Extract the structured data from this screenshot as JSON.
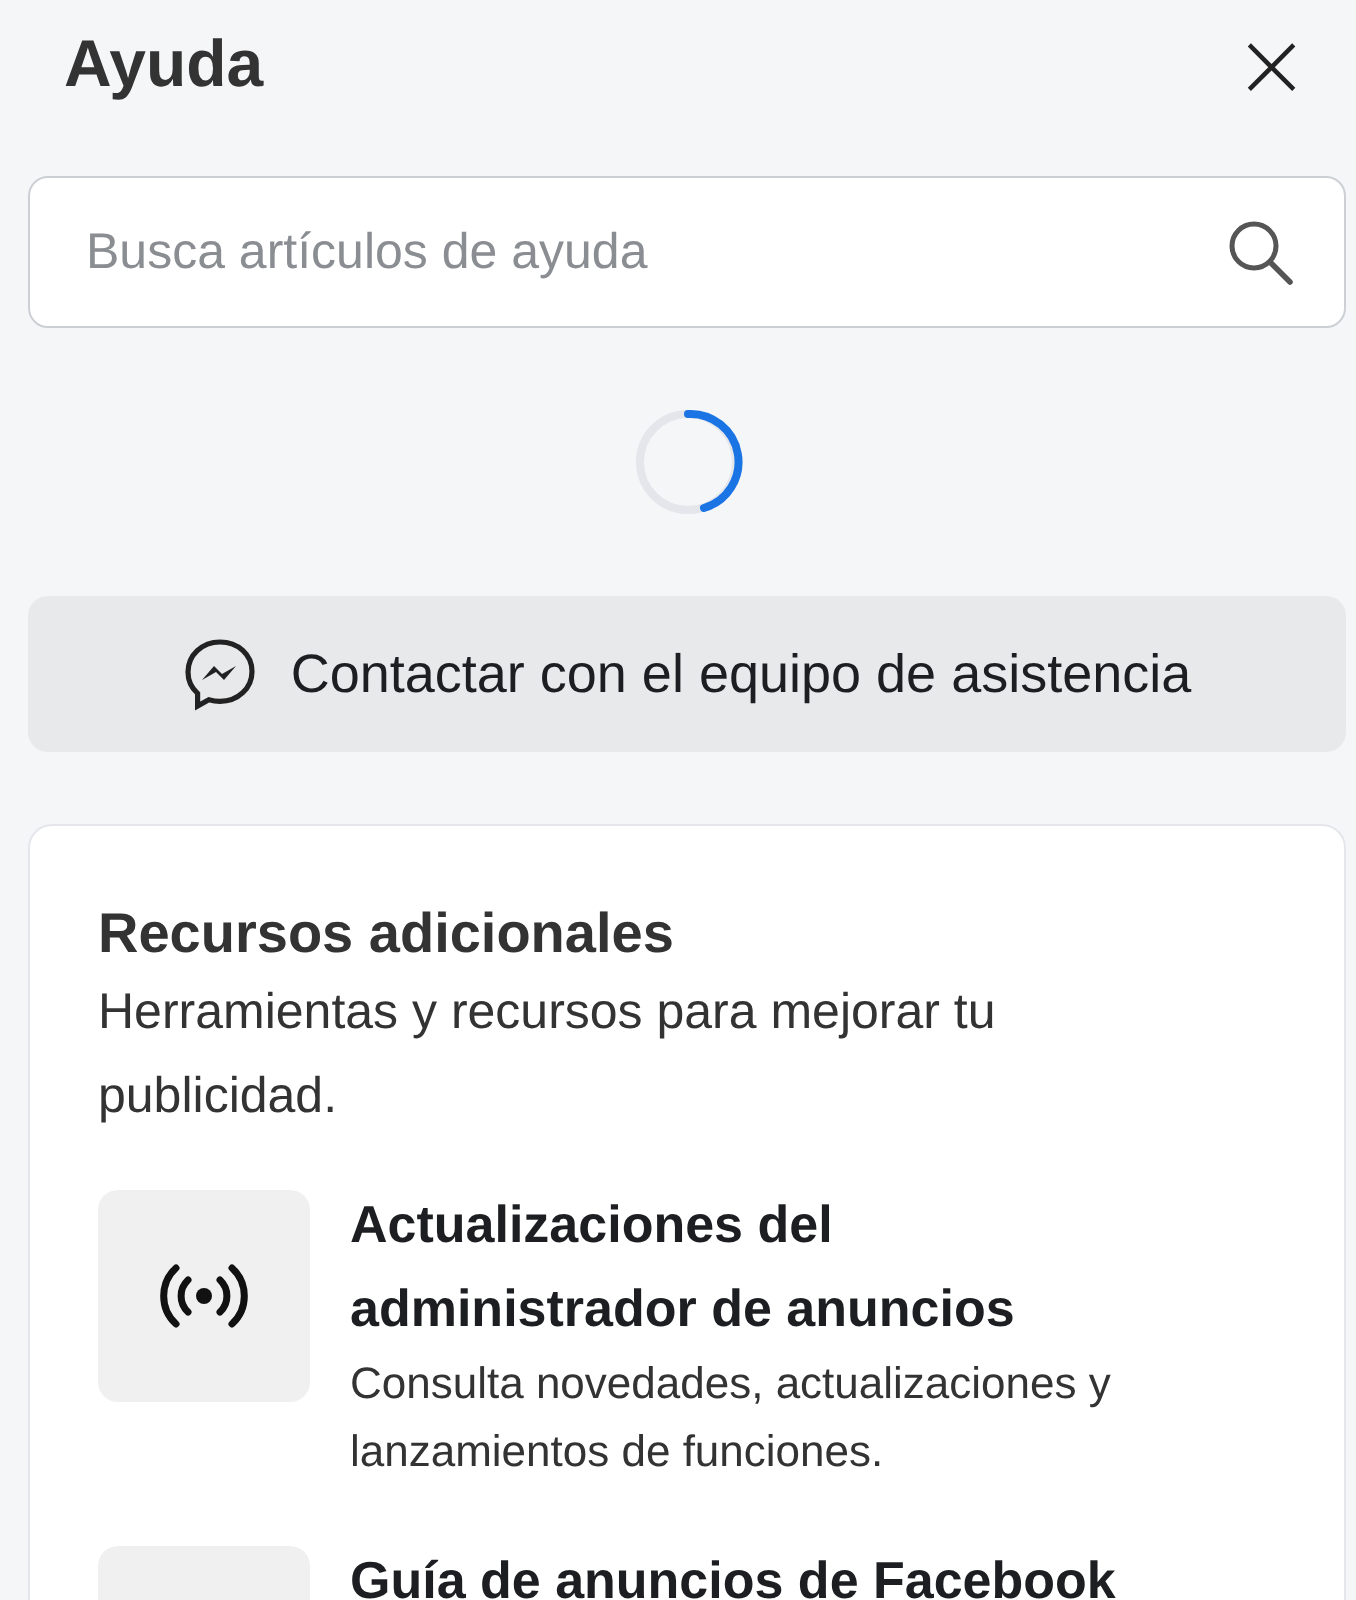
{
  "header": {
    "title": "Ayuda",
    "close": "×"
  },
  "search": {
    "placeholder": "Busca artículos de ayuda"
  },
  "loading": true,
  "contact_button": {
    "label": "Contactar con el equipo de asistencia"
  },
  "resources": {
    "title": "Recursos adicionales",
    "subtitle": "Herramientas y recursos para mejorar tu publicidad.",
    "items": [
      {
        "kind": "broadcast",
        "title": "Actualizaciones del administrador de anuncios",
        "description": "Consulta novedades, actualizaciones y lanzamientos de funciones."
      },
      {
        "kind": "blank",
        "title": "Guía de anuncios de Facebook"
      }
    ]
  }
}
